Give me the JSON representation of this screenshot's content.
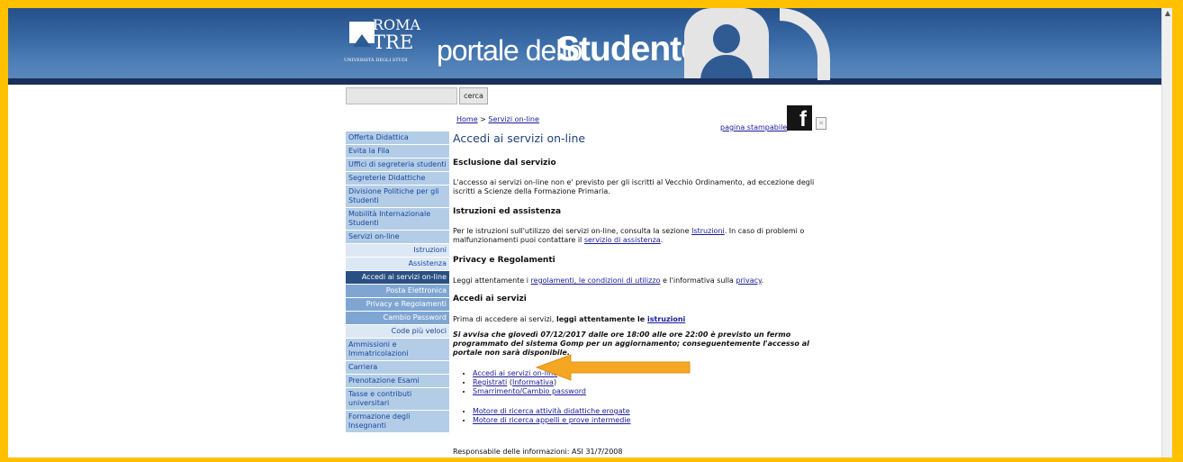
{
  "header": {
    "logo_roma": "ROMA",
    "logo_tre": "TRE",
    "logo_univ": "UNIVERSITÀ DEGLI STUDI",
    "title_portale": "portale dello",
    "title_studente": "Studente"
  },
  "search": {
    "value": "",
    "button": "cerca"
  },
  "breadcrumb": {
    "home": "Home",
    "separator": ">",
    "current": "Servizi on-line"
  },
  "toolbar": {
    "print": "pagina stampabile"
  },
  "sidebar": {
    "items": [
      {
        "label": "Offerta Didattica"
      },
      {
        "label": "Evita la Fila"
      },
      {
        "label": "Uffici di segreteria studenti"
      },
      {
        "label": "Segreterie Didattiche"
      },
      {
        "label": "Divisione Politiche per gli Studenti"
      },
      {
        "label": "Mobilità Internazionale Studenti"
      },
      {
        "label": "Servizi on-line"
      },
      {
        "label": "Istruzioni"
      },
      {
        "label": "Assistenza"
      },
      {
        "label": "Accedi ai servizi on-line"
      },
      {
        "label": "Posta Elettronica"
      },
      {
        "label": "Privacy e Regolamenti"
      },
      {
        "label": "Cambio Password"
      },
      {
        "label": "Code più veloci"
      },
      {
        "label": "Ammissioni e Immatricolazioni"
      },
      {
        "label": "Carriera"
      },
      {
        "label": "Prenotazione Esami"
      },
      {
        "label": "Tasse e contributi universitari"
      },
      {
        "label": "Formazione degli Insegnanti"
      }
    ]
  },
  "main": {
    "title": "Accedi ai servizi on-line",
    "sec1_head": "Esclusione dal servizio",
    "sec1_text": "L'accesso ai servizi on-line non e' previsto per gli iscritti al Vecchio Ordinamento, ad eccezione degli iscritti a Scienze della Formazione Primaria.",
    "sec2_head": "Istruzioni ed assistenza",
    "sec2_text_a": "Per le istruzioni sull'utilizzo dei servizi on-line, consulta la sezione ",
    "sec2_link_a": "Istruzioni",
    "sec2_text_b": ". In caso di problemi o malfunzionamenti puoi contattare il ",
    "sec2_link_b": "servizio di assistenza",
    "sec2_text_c": ".",
    "sec3_head": "Privacy e Regolamenti",
    "sec3_text_a": "Leggi attentamente i ",
    "sec3_link_a": "regolamenti, le condizioni di utilizzo",
    "sec3_text_b": " e l'informativa sulla ",
    "sec3_link_b": "privacy",
    "sec3_text_c": ".",
    "sec4_head": "Accedi ai servizi",
    "sec4_text_a": "Prima di accedere ai servizi, ",
    "sec4_text_bold": "leggi attentamente le ",
    "sec4_link": "istruzioni",
    "notice": "Si avvisa che giovedì 07/12/2017 dalle ore 18:00 alle ore 22:00 è previsto un fermo programmato del sistema Gomp per un aggiornamento; conseguentemente l'accesso al portale non sarà disponibile.",
    "links": {
      "accedi": "Accedi ai servizi on-line",
      "registrati": "Registrati",
      "informativa_open": " (",
      "informativa": "Informativa",
      "informativa_close": ")",
      "smarrimento": "Smarrimento/Cambio password",
      "motore_attivita": "Motore di ricerca attività didattiche erogate",
      "motore_appelli": "Motore di ricerca appelli e prove intermedie"
    },
    "footer": "Responsabile delle informazioni: ASI 31/7/2008"
  },
  "colors": {
    "frame": "#ffc000",
    "header_blue": "#3a6aa5",
    "sidebar_main": "#b3cde6",
    "sidebar_active": "#2a5083",
    "arrow": "#f5a623"
  }
}
